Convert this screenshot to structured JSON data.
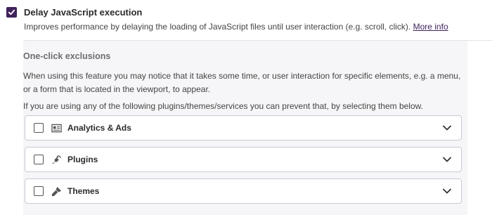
{
  "setting": {
    "title": "Delay JavaScript execution",
    "description": "Improves performance by delaying the loading of JavaScript files until user interaction (e.g. scroll, click).",
    "more_info": "More info",
    "checked": true
  },
  "exclusions": {
    "title": "One-click exclusions",
    "paragraph1": "When using this feature you may notice that it takes some time, or user interaction for specific elements, e.g. a menu, or a form that is located in the viewport, to appear.",
    "paragraph2": "If you are using any of the following plugins/themes/services you can prevent that, by selecting them below.",
    "groups": [
      {
        "label": "Analytics & Ads",
        "icon": "analytics-icon"
      },
      {
        "label": "Plugins",
        "icon": "plugin-icon"
      },
      {
        "label": "Themes",
        "icon": "brush-icon"
      }
    ]
  },
  "colors": {
    "accent": "#40225b"
  }
}
